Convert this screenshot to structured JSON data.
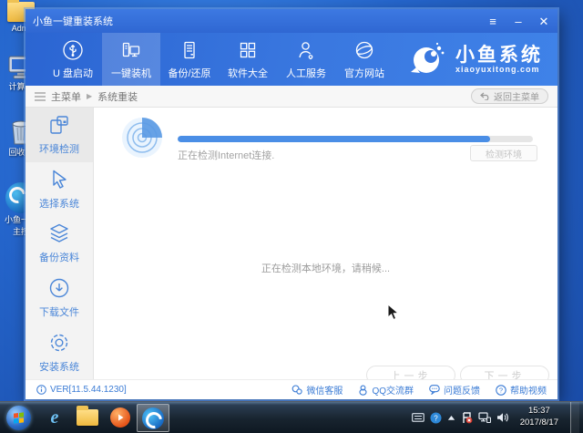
{
  "colors": {
    "accent_blue": "#3a7bd5",
    "nav_blue": "#2e6bd6",
    "progress_fill": "#4a8ee6",
    "sidebar_bg": "#f3f3f3",
    "taskbar_dark": "#18242f"
  },
  "desktop": {
    "icons": [
      {
        "label": "Admi"
      },
      {
        "label": "计算机"
      },
      {
        "label": "回收站"
      },
      {
        "label": "小鱼一键",
        "label2": "主控"
      }
    ]
  },
  "taskbar": {
    "time": "15:37",
    "date": "2017/8/17"
  },
  "window": {
    "title": "小鱼一键重装系统",
    "controls": {
      "menu": "≡",
      "minimize": "–",
      "close": "✕"
    },
    "nav": {
      "items": [
        {
          "label": "U 盘启动"
        },
        {
          "label": "一键装机"
        },
        {
          "label": "备份/还原"
        },
        {
          "label": "软件大全"
        },
        {
          "label": "人工服务"
        },
        {
          "label": "官方网站"
        }
      ],
      "brand": {
        "name": "小鱼系统",
        "domain": "xiaoyuxitong.com"
      }
    },
    "breadcrumb": {
      "root": "主菜单",
      "separator": "▶",
      "current": "系统重装",
      "back_button": "返回主菜单"
    },
    "sidebar": {
      "items": [
        {
          "label": "环境检测"
        },
        {
          "label": "选择系统"
        },
        {
          "label": "备份资料"
        },
        {
          "label": "下载文件"
        },
        {
          "label": "安装系统"
        }
      ]
    },
    "main": {
      "progress_status": "正在检测Internet连接.",
      "progress_percent": 88,
      "detect_button": "检测环境",
      "waiting_message": "正在检测本地环境，请稍候...",
      "prev_button": "上一步",
      "next_button": "下一步"
    },
    "statusbar": {
      "version": "VER[11.5.44.1230]",
      "links": [
        {
          "label": "微信客服"
        },
        {
          "label": "QQ交流群"
        },
        {
          "label": "问题反馈"
        },
        {
          "label": "帮助视频"
        }
      ]
    }
  }
}
